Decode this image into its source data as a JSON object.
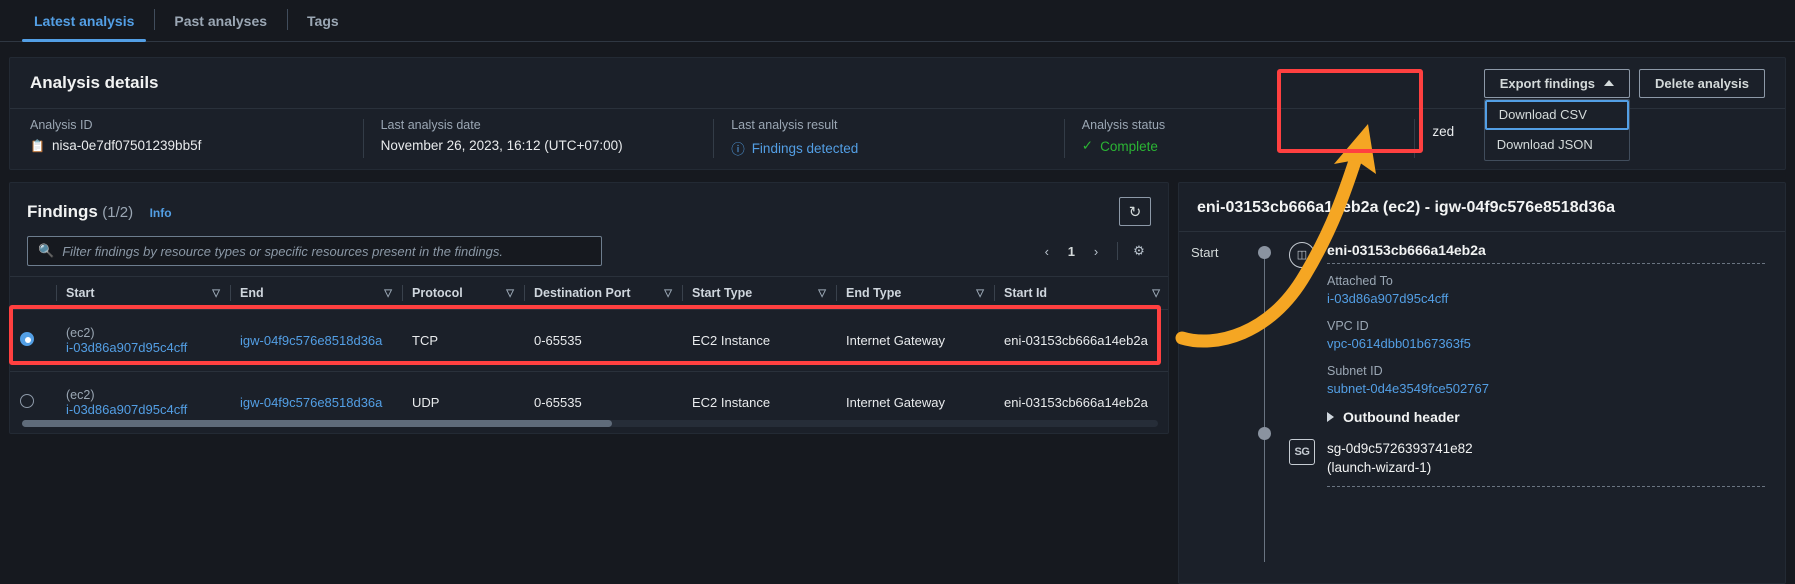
{
  "tabs": [
    {
      "label": "Latest analysis",
      "active": true
    },
    {
      "label": "Past analyses",
      "active": false
    },
    {
      "label": "Tags",
      "active": false
    }
  ],
  "details": {
    "title": "Analysis details",
    "export_button": "Export findings",
    "delete_button": "Delete analysis",
    "dropdown": {
      "items": [
        {
          "label": "Download CSV",
          "focused": true
        },
        {
          "label": "Download JSON",
          "focused": false
        }
      ]
    },
    "fields": [
      {
        "label": "Analysis ID",
        "value": "nisa-0e7df07501239bb5f",
        "icon": "copy-icon",
        "style": "plain"
      },
      {
        "label": "Last analysis date",
        "value": "November 26, 2023, 16:12 (UTC+07:00)",
        "style": "plain"
      },
      {
        "label": "Last analysis result",
        "value": "Findings detected",
        "icon": "info-circle-icon",
        "style": "link"
      },
      {
        "label": "Analysis status",
        "value": "Complete",
        "icon": "check-circle-icon",
        "style": "ok"
      },
      {
        "label": "",
        "value": "zed",
        "style": "plain"
      }
    ]
  },
  "findings": {
    "title": "Findings",
    "count": "(1/2)",
    "info_label": "Info",
    "refresh_icon": "refresh-icon",
    "settings_icon": "gear-icon",
    "search_placeholder": "Filter findings by resource types or specific resources present in the findings.",
    "search_value": "",
    "page_number": "1",
    "columns": [
      "Start",
      "End",
      "Protocol",
      "Destination Port",
      "Start Type",
      "End Type",
      "Start Id"
    ],
    "rows": [
      {
        "selected": true,
        "start_type_label": "(ec2)",
        "start_id_link": "i-03d86a907d95c4cff",
        "end": "igw-04f9c576e8518d36a",
        "protocol": "TCP",
        "destination_port": "0-65535",
        "start_type": "EC2 Instance",
        "end_type": "Internet Gateway",
        "start_id": "eni-03153cb666a14eb2a"
      },
      {
        "selected": false,
        "start_type_label": "(ec2)",
        "start_id_link": "i-03d86a907d95c4cff",
        "end": "igw-04f9c576e8518d36a",
        "protocol": "UDP",
        "destination_port": "0-65535",
        "start_type": "EC2 Instance",
        "end_type": "Internet Gateway",
        "start_id": "eni-03153cb666a14eb2a"
      }
    ]
  },
  "detail": {
    "title": "eni-03153cb666a14eb2a (ec2) - igw-04f9c576e8518d36a",
    "timeline_label": "Start",
    "node": {
      "icon": "network-interface-icon",
      "heading": "eni-03153cb666a14eb2a",
      "properties": [
        {
          "label": "Attached To",
          "value": "i-03d86a907d95c4cff"
        },
        {
          "label": "VPC ID",
          "value": "vpc-0614dbb01b67363f5"
        },
        {
          "label": "Subnet ID",
          "value": "subnet-0d4e3549fce502767"
        }
      ],
      "expand_label": "Outbound header"
    },
    "security_group": {
      "icon_label": "SG",
      "name_line1": "sg-0d9c5726393741e82",
      "name_line2": "(launch-wizard-1)"
    }
  }
}
